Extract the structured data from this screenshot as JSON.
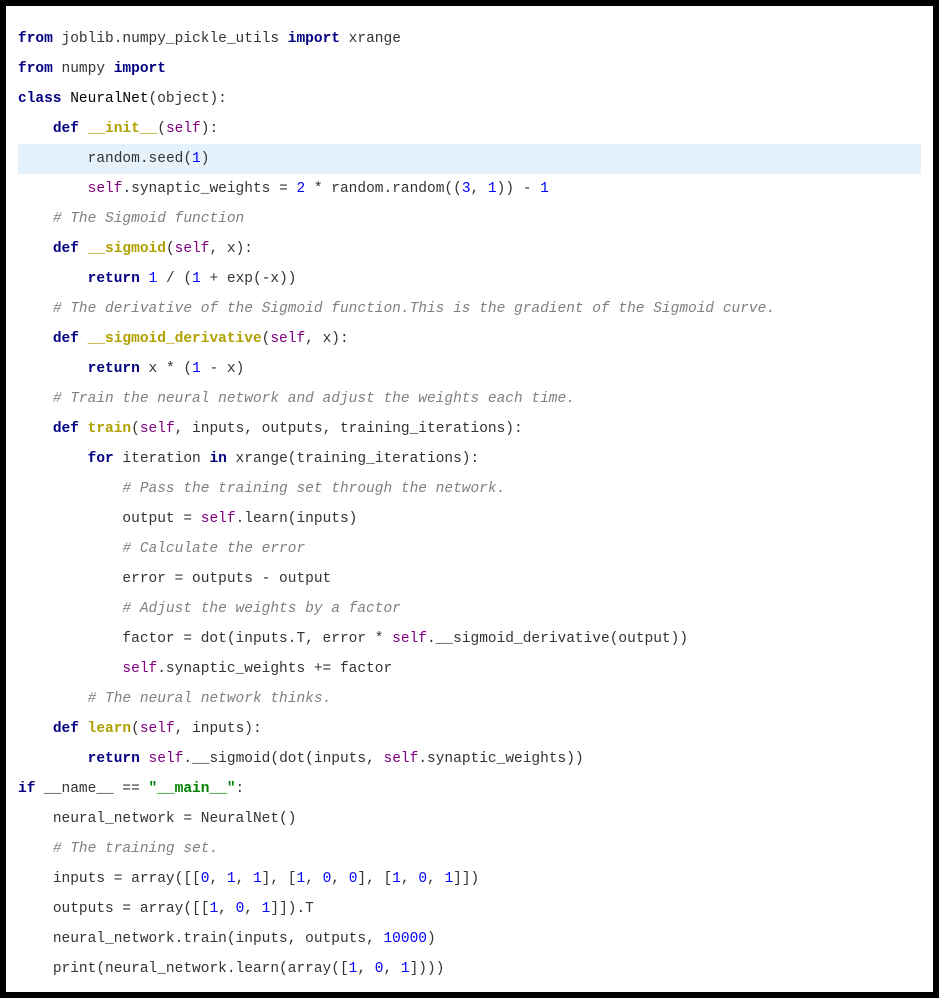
{
  "code": {
    "l1": {
      "from": "from",
      "mod": " joblib.numpy_pickle_utils ",
      "imp": "import",
      "what": " xrange"
    },
    "l2": {
      "from": "from",
      "mod": " numpy ",
      "imp": "import"
    },
    "l3": {
      "kw": "class",
      "name": " NeuralNet",
      "paren": "(object):"
    },
    "l4": {
      "def": "def",
      "name": "__init__",
      "sig": "(",
      "self": "self",
      "close": "):"
    },
    "l5": {
      "text": "random.seed(",
      "n": "1",
      "close": ")"
    },
    "l6": {
      "self": "self",
      "dot": ".synaptic_weights = ",
      "n2": "2",
      "mid": " * random.random((",
      "n3": "3",
      "c1": ", ",
      "n1": "1",
      "p": ")) - ",
      "nm1": "1"
    },
    "l7": {
      "cm": "# The Sigmoid function"
    },
    "l8": {
      "def": "def",
      "name": "__sigmoid",
      "sig": "(",
      "self": "self",
      "c": ", x):"
    },
    "l9": {
      "ret": "return",
      "sp": " ",
      "n": "1",
      "mid": " / (",
      "n2": "1",
      "p": " + exp(-x))"
    },
    "l10": {
      "cm": "# The derivative of the Sigmoid function.This is the gradient of the Sigmoid curve."
    },
    "l11": {
      "def": "def",
      "name": "__sigmoid_derivative",
      "sig": "(",
      "self": "self",
      "c": ", x):"
    },
    "l12": {
      "ret": "return",
      "sp": " x * (",
      "n": "1",
      "p": " - x)"
    },
    "l13": {
      "cm": "# Train the neural network and adjust the weights each time."
    },
    "l14": {
      "def": "def",
      "name": "train",
      "sig": "(",
      "self": "self",
      "c": ", inputs, outputs, training_iterations):"
    },
    "l15": {
      "for": "for",
      "mid": " iteration ",
      "in": "in",
      "rest": " xrange(training_iterations):"
    },
    "l16": {
      "cm": "# Pass the training set through the network."
    },
    "l17": {
      "a": "output = ",
      "self": "self",
      "b": ".learn(inputs)"
    },
    "l18": {
      "cm": "# Calculate the error"
    },
    "l19": {
      "a": "error = outputs - output"
    },
    "l20": {
      "cm": "# Adjust the weights by a factor"
    },
    "l21": {
      "a": "factor = dot(inputs.T, error * ",
      "self": "self",
      "b": ".__sigmoid_derivative(output))"
    },
    "l22": {
      "self": "self",
      "a": ".synaptic_weights += factor"
    },
    "l23": {
      "cm": "# The neural network thinks."
    },
    "l24": {
      "def": "def",
      "name": "learn",
      "sig": "(",
      "self": "self",
      "c": ", inputs):"
    },
    "l25": {
      "ret": "return",
      "sp": " ",
      "self": "self",
      "a": ".__sigmoid(dot(inputs, ",
      "self2": "self",
      "b": ".synaptic_weights))"
    },
    "l26": {
      "kw": "if",
      "mid": " __name__ == ",
      "str": "\"__main__\"",
      "c": ":"
    },
    "l27": {
      "a": "neural_network = NeuralNet()"
    },
    "l28": {
      "cm": "# The training set."
    },
    "l29": {
      "a": "inputs = array([[",
      "n0": "0",
      "c1": ", ",
      "n1": "1",
      "c2": ", ",
      "n2": "1",
      "m": "], [",
      "n3": "1",
      "c3": ", ",
      "n4": "0",
      "c4": ", ",
      "n5": "0",
      "m2": "], [",
      "n6": "1",
      "c5": ", ",
      "n7": "0",
      "c6": ", ",
      "n8": "1",
      "e": "]])"
    },
    "l30": {
      "a": "outputs = array([[",
      "n0": "1",
      "c1": ", ",
      "n1": "0",
      "c2": ", ",
      "n2": "1",
      "e": "]]).T"
    },
    "l31": {
      "a": "neural_network.train(inputs, outputs, ",
      "n": "10000",
      "e": ")"
    },
    "l32": {
      "a": "print(neural_network.learn(array([",
      "n0": "1",
      "c1": ", ",
      "n1": "0",
      "c2": ", ",
      "n2": "1",
      "e": "])))"
    }
  }
}
